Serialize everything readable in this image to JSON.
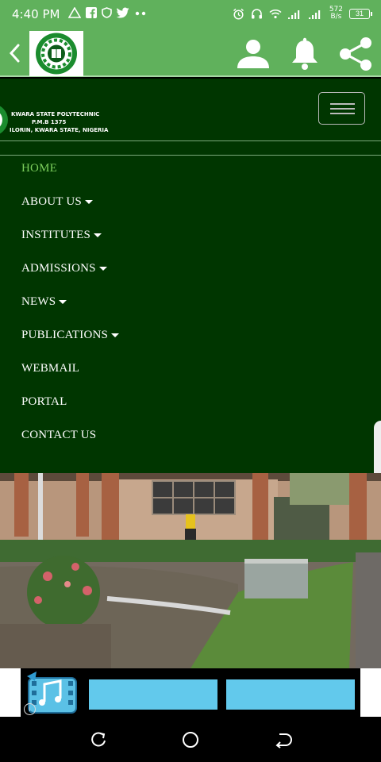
{
  "status_bar": {
    "time": "4:40 PM",
    "left_icons": [
      "warning-triangle-icon",
      "facebook-icon",
      "shield-icon",
      "twitter-icon",
      "more-dots-icon"
    ],
    "right_icons": [
      "alarm-icon",
      "headset-icon",
      "wifi-icon",
      "signal-icon",
      "signal-icon"
    ],
    "net_speed_value": "572",
    "net_speed_unit": "B/s",
    "battery": "31"
  },
  "app_bar": {
    "icons": [
      "back-icon",
      "profile-icon",
      "bell-icon",
      "share-icon"
    ],
    "color": "#60b15c"
  },
  "site_header": {
    "title_line1": "KWARA STATE POLYTECHNIC",
    "title_line2": "P.M.B 1375",
    "title_line3": "ILORIN, KWARA STATE, NIGERIA"
  },
  "nav": {
    "items": [
      {
        "label": "HOME",
        "active": true,
        "dropdown": false
      },
      {
        "label": "ABOUT US",
        "active": false,
        "dropdown": true
      },
      {
        "label": "INSTITUTES",
        "active": false,
        "dropdown": true
      },
      {
        "label": "ADMISSIONS",
        "active": false,
        "dropdown": true
      },
      {
        "label": "NEWS",
        "active": false,
        "dropdown": true
      },
      {
        "label": "PUBLICATIONS",
        "active": false,
        "dropdown": true
      },
      {
        "label": "WEBMAIL",
        "active": false,
        "dropdown": false
      },
      {
        "label": "PORTAL",
        "active": false,
        "dropdown": false
      },
      {
        "label": "CONTACT US",
        "active": false,
        "dropdown": false
      }
    ]
  },
  "ad": {
    "info_glyph": "i",
    "icon": "music-video-icon"
  },
  "system_nav": {
    "icons": [
      "recents-icon",
      "home-circle-icon",
      "back-arrow-icon"
    ]
  },
  "colors": {
    "nav_bg": "#003600",
    "active": "#7ccf5c",
    "ad_button": "#62c9ec"
  }
}
